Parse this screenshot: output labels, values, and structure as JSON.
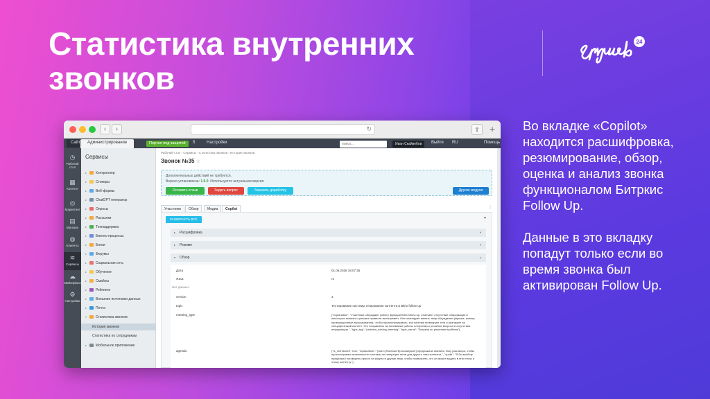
{
  "slide": {
    "title_line1": "Статистика внутренних",
    "title_line2": "звонков",
    "logo_text": "Skyweb",
    "logo_badge": "24",
    "desc_p1": "Во вкладке «Copilot» находится расшифровка, резюмирование, обзор, оценка и анализ звонка функционалом Битркис Follow Up.",
    "desc_p2": "Данные в это вкладку попадут только если во время звонка был активирован Follow Up."
  },
  "browser": {
    "back": "‹",
    "forward": "›",
    "reload": "↻",
    "share": "⇪",
    "plus": "+"
  },
  "adminbar": {
    "site": "Сайт",
    "admin": "Администрирование",
    "portal_btn": "Портал под защитой",
    "count": "5",
    "settings": "Настройки",
    "search_placeholder": "поиск...",
    "user": "Иван Скайвебов",
    "logout": "Выйти",
    "lang": "RU",
    "help": "Помощь"
  },
  "leftnav": [
    {
      "icon": "◷",
      "label": "Рабочий стол"
    },
    {
      "icon": "▦",
      "label": "Контент"
    },
    {
      "icon": "◎",
      "label": "Маркетинг"
    },
    {
      "icon": "▤",
      "label": "Магазин"
    },
    {
      "icon": "◍",
      "label": "Клиенты"
    },
    {
      "icon": "≋",
      "label": "Сервисы"
    },
    {
      "icon": "☁",
      "label": "Marketplace"
    },
    {
      "icon": "⚙",
      "label": "Настройки"
    }
  ],
  "sidebar": {
    "title": "Сервисы",
    "items": [
      "Контроллер",
      "Стикеры",
      "Веб-формы",
      "ChatGPT генератор",
      "Опросы",
      "Рассылки",
      "Техподдержка",
      "Бизнес-процессы",
      "Блоги",
      "Форумы",
      "Социальная сеть",
      "Обучение",
      "Смайлы",
      "Рейтинги",
      "Внешние источники данных",
      "Почта",
      "Статистика звонков",
      "История звонков",
      "Статистика по сотрудникам",
      "Мобильное приложение"
    ]
  },
  "content": {
    "breadcrumb": "Рабочий стол  ›  Сервисы  ›  Статистика звонков  ›  История звонков",
    "title": "Звонок №35",
    "star": "☆",
    "info_line1": "Дополнительных действий не требуется.",
    "info_line2_prefix": "Версия установлена: ",
    "info_version": "1.0.0",
    "info_line2_suffix": ". Используется актуальная версия.",
    "buttons": {
      "feedback": "Оставить отзыв",
      "ask": "Задать вопрос",
      "order": "Заказать доработку",
      "modules": "Другие модули"
    },
    "tabs": [
      "Участники",
      "Обзор",
      "Медиа",
      "Copilot"
    ],
    "tabs_more": "⋮",
    "expand_all": "РАЗВЕРНУТЬ ВСЕ",
    "accordions": [
      "Расшифровка",
      "Резюме",
      "Обзор"
    ],
    "rows": [
      {
        "k": "Дата",
        "v": "01.06.2026 18:07:35"
      },
      {
        "k": "Язык",
        "v": "ru"
      },
      {
        "k": "Нет данных",
        "v": ""
      },
      {
        "k": "version",
        "v": "3"
      },
      {
        "k": "topic",
        "v": "Тестирование системы тегирования контента в Bitrix follow-up"
      },
      {
        "k": "meeting_type",
        "v": "{\"explanation\": \"Участники обсуждают работу функции Bitrix follow-up, отмечают отсутствие информации в некоторых записях и решают провести эксперимент. Они планируют менять тему обсуждения (музыка, кинопр. провокационные высказывания), чтобы проанализировать, как система генерирует теги и реагирует на специфический контент. Это направлено на понимание работы алгоритма и решение вопроса в отсутствии информации.\", \"type_tag\": \"problem_solving_meeting\", \"type_name\": \"Встреча по решению проблем\"}"
      },
      {
        "k": "agenda",
        "v": "{\"is_mentioned\": true, \"explanation\": \"[user=]Наталья Фролова[/user] предложила сменить тему разговора, чтобы протестировать возможности системы по генерации тегов для другого типа контента.\", \"quote\": \"Я бы вообще предложил поговорить просто на какую-то другую тему, чтобы посмотреть, что он может выдать в этих тегах и этому контенту.\"}"
      }
    ]
  },
  "colors": {
    "green": "#3ab54a",
    "red": "#e0463e",
    "cyan": "#24c3e6",
    "blue": "#1f7fd1",
    "expand": "#26bde8"
  }
}
